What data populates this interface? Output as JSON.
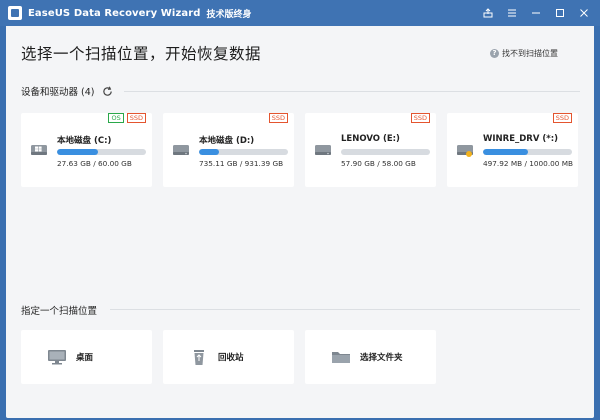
{
  "window": {
    "title": "EaseUS Data Recovery Wizard",
    "edition": "技术版终身"
  },
  "header": {
    "headline": "选择一个扫描位置，开始恢复数据",
    "help_text": "找不到扫描位置"
  },
  "devices": {
    "section_title": "设备和驱动器 (4)",
    "drives": [
      {
        "name": "本地磁盘 (C:)",
        "size": "27.63 GB / 60.00 GB",
        "used_fraction": 0.46,
        "badges": [
          "OS",
          "SSD"
        ],
        "icon": "windows-drive-icon"
      },
      {
        "name": "本地磁盘 (D:)",
        "size": "735.11 GB / 931.39 GB",
        "used_fraction": 0.23,
        "badges": [
          "SSD"
        ],
        "icon": "hard-drive-icon"
      },
      {
        "name": "LENOVO (E:)",
        "size": "57.90 GB / 58.00 GB",
        "used_fraction": 0.0,
        "badges": [
          "SSD"
        ],
        "icon": "hard-drive-icon"
      },
      {
        "name": "WINRE_DRV (*:)",
        "size": "497.92 MB / 1000.00 MB",
        "used_fraction": 0.5,
        "badges": [
          "SSD"
        ],
        "icon": "hard-drive-warning-icon"
      }
    ]
  },
  "locations": {
    "section_title": "指定一个扫描位置",
    "items": [
      {
        "label": "桌面",
        "icon": "desktop-icon"
      },
      {
        "label": "回收站",
        "icon": "recycle-bin-icon"
      },
      {
        "label": "选择文件夹",
        "icon": "folder-icon"
      }
    ]
  },
  "colors": {
    "titlebar": "#3f73b3",
    "progress": "#3a8fe0",
    "badge_os": "#2aa84a",
    "badge_ssd": "#e4552f",
    "background": "#f4f5f7"
  }
}
